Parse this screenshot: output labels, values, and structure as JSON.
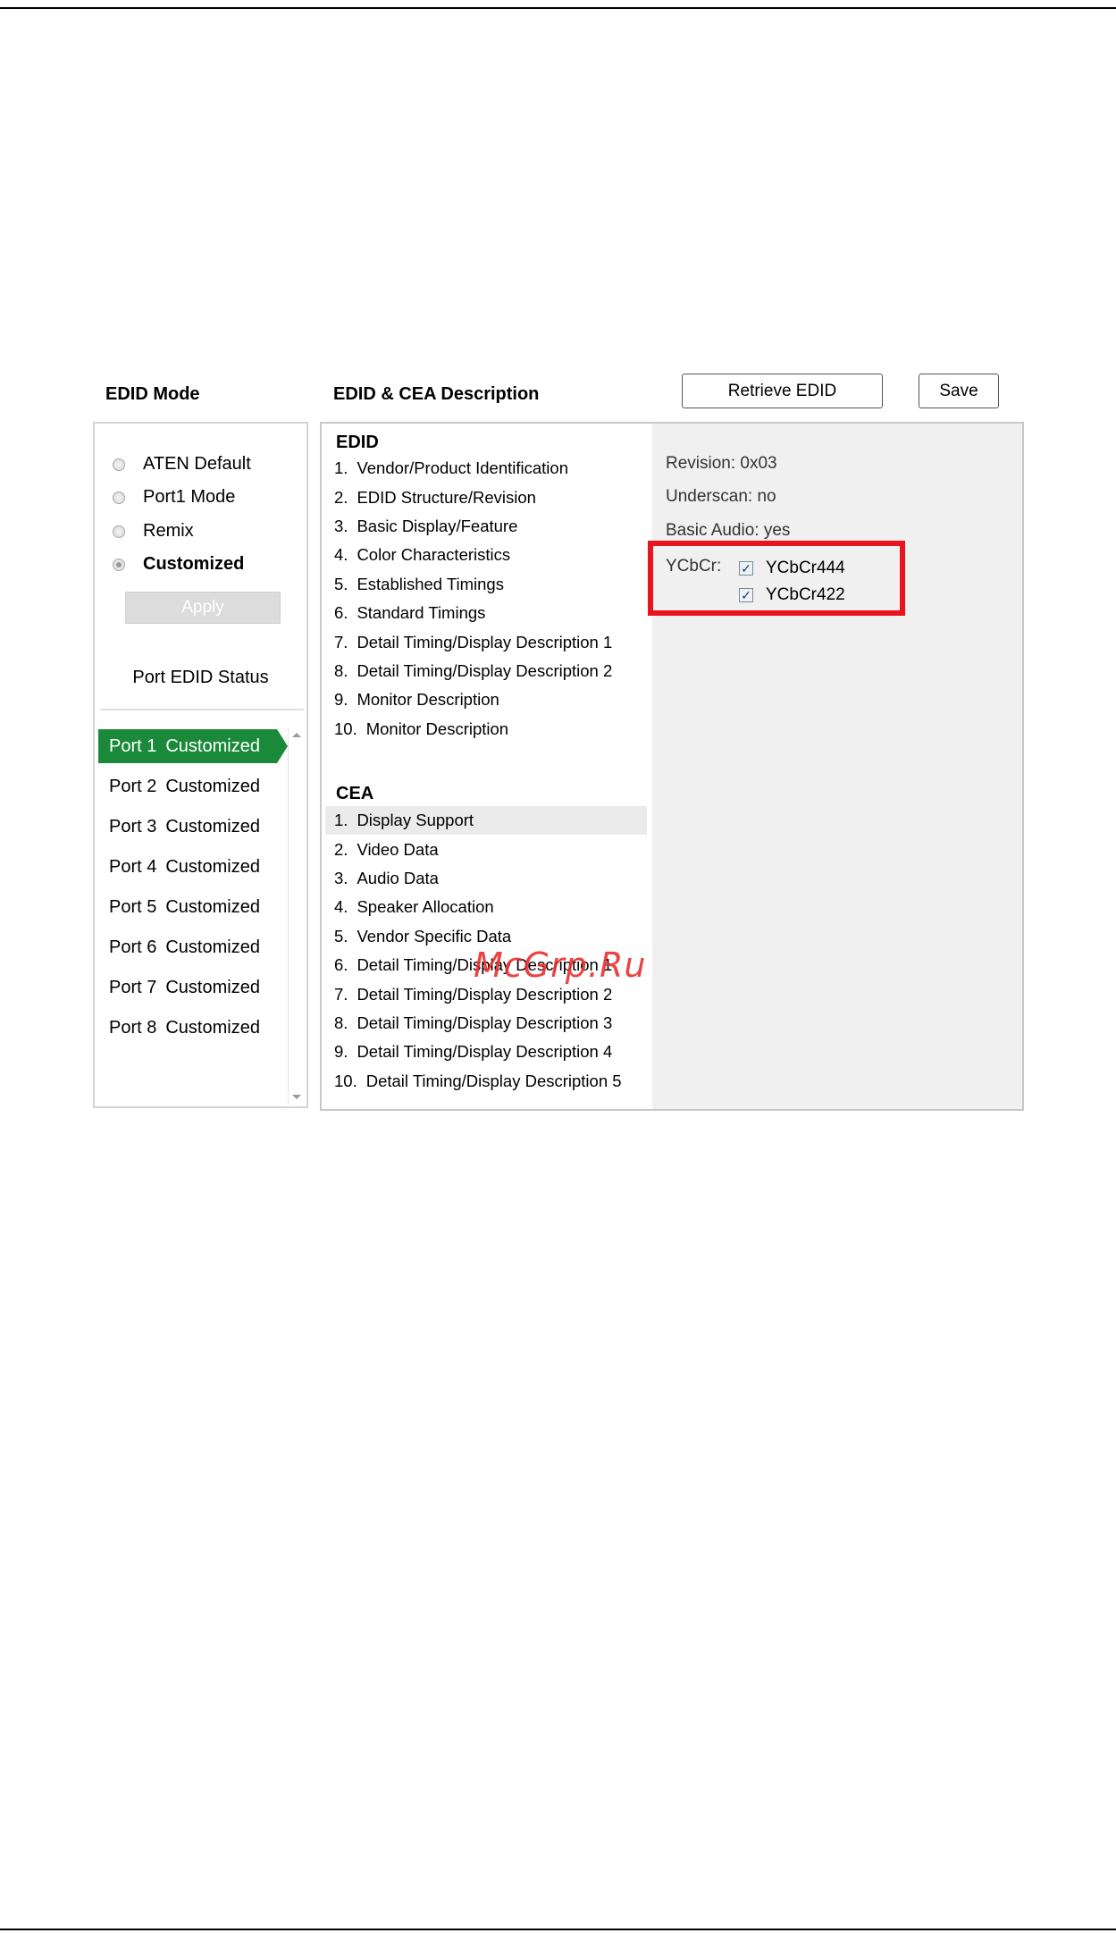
{
  "headings": {
    "edid_mode": "EDID Mode",
    "description": "EDID & CEA Description"
  },
  "buttons": {
    "retrieve": "Retrieve EDID",
    "save": "Save",
    "apply": "Apply"
  },
  "modes": [
    {
      "label": "ATEN Default",
      "checked": false
    },
    {
      "label": "Port1 Mode",
      "checked": false
    },
    {
      "label": "Remix",
      "checked": false
    },
    {
      "label": "Customized",
      "checked": true
    }
  ],
  "port_status": {
    "title": "Port EDID Status",
    "ports": [
      {
        "port": "Port 1",
        "status": "Customized",
        "selected": true
      },
      {
        "port": "Port 2",
        "status": "Customized"
      },
      {
        "port": "Port 3",
        "status": "Customized"
      },
      {
        "port": "Port 4",
        "status": "Customized"
      },
      {
        "port": "Port 5",
        "status": "Customized"
      },
      {
        "port": "Port 6",
        "status": "Customized"
      },
      {
        "port": "Port 7",
        "status": "Customized"
      },
      {
        "port": "Port 8",
        "status": "Customized"
      }
    ]
  },
  "edid": {
    "title": "EDID",
    "items": [
      {
        "num": "1.",
        "label": "Vendor/Product Identification"
      },
      {
        "num": "2.",
        "label": "EDID Structure/Revision"
      },
      {
        "num": "3.",
        "label": "Basic Display/Feature"
      },
      {
        "num": "4.",
        "label": "Color Characteristics"
      },
      {
        "num": "5.",
        "label": "Established Timings"
      },
      {
        "num": "6.",
        "label": "Standard Timings"
      },
      {
        "num": "7.",
        "label": "Detail Timing/Display Description 1"
      },
      {
        "num": "8.",
        "label": "Detail Timing/Display Description 2"
      },
      {
        "num": "9.",
        "label": "Monitor Description"
      },
      {
        "num": "10.",
        "label": "Monitor Description"
      }
    ]
  },
  "cea": {
    "title": "CEA",
    "items": [
      {
        "num": "1.",
        "label": "Display Support",
        "highlight": true
      },
      {
        "num": "2.",
        "label": "Video Data"
      },
      {
        "num": "3.",
        "label": "Audio Data"
      },
      {
        "num": "4.",
        "label": "Speaker Allocation"
      },
      {
        "num": "5.",
        "label": "Vendor Specific Data"
      },
      {
        "num": "6.",
        "label": "Detail Timing/Display Description 1"
      },
      {
        "num": "7.",
        "label": "Detail Timing/Display Description 2"
      },
      {
        "num": "8.",
        "label": "Detail Timing/Display Description 3"
      },
      {
        "num": "9.",
        "label": "Detail Timing/Display Description 4"
      },
      {
        "num": "10.",
        "label": "Detail Timing/Display Description 5"
      }
    ]
  },
  "details": {
    "revision": "Revision: 0x03",
    "underscan": "Underscan: no",
    "basic_audio": "Basic Audio: yes",
    "ycbcr_label": "YCbCr:",
    "ycbcr444": "YCbCr444",
    "ycbcr422": "YCbCr422",
    "checkmark": "✓"
  },
  "watermark": "McGrp.Ru",
  "colors": {
    "selected_port": "#1a8a3a",
    "highlight_box": "#e8141e"
  }
}
